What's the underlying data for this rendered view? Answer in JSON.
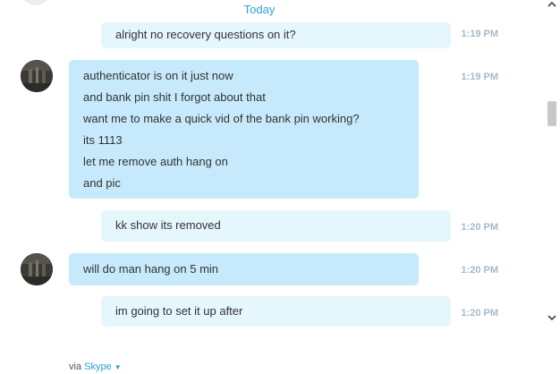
{
  "conversation": {
    "date_divider": "Today",
    "messages": [
      {
        "direction": "out",
        "lines": [
          "alright no recovery questions on it?"
        ],
        "time": "1:19 PM"
      },
      {
        "direction": "in",
        "lines": [
          "authenticator is on it just now",
          "and bank pin shit I forgot about that",
          "want me to make a quick vid of the bank pin working?",
          "its 1113",
          "let me remove auth hang on",
          "and pic"
        ],
        "time": "1:19 PM"
      },
      {
        "direction": "out",
        "lines": [
          "kk show its removed"
        ],
        "time": "1:20 PM"
      },
      {
        "direction": "in",
        "lines": [
          "will do man hang on 5 min"
        ],
        "time": "1:20 PM"
      },
      {
        "direction": "out",
        "lines": [
          "im going to set it up after"
        ],
        "time": "1:20 PM"
      }
    ]
  },
  "footer": {
    "via_label": "via",
    "service_link": "Skype"
  },
  "colors": {
    "accent": "#2d9fd9",
    "incoming_bubble": "#c6eafb",
    "outgoing_bubble": "#e5f6fd",
    "timestamp": "#a9b9c4"
  },
  "icons": {
    "scroll_up": "chevron-up-icon",
    "scroll_down": "chevron-down-icon",
    "dropdown": "caret-down-icon"
  }
}
